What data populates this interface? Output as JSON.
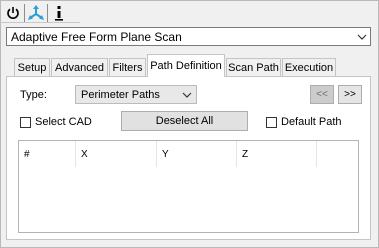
{
  "toolbar": {
    "icons": [
      "power-icon",
      "move-axes-icon",
      "info-icon"
    ],
    "power_glyph": "⏻",
    "move_glyph": "✥",
    "info_glyph": "i"
  },
  "scan_type": {
    "selected": "Adaptive Free Form Plane Scan"
  },
  "tabs": [
    {
      "label": "Setup",
      "active": false
    },
    {
      "label": "Advanced",
      "active": false
    },
    {
      "label": "Filters",
      "active": false
    },
    {
      "label": "Path Definition",
      "active": true
    },
    {
      "label": "Scan Path",
      "active": false
    },
    {
      "label": "Execution",
      "active": false
    }
  ],
  "path_definition": {
    "type_label": "Type:",
    "type_value": "Perimeter Paths",
    "prev_label": "<<",
    "next_label": ">>",
    "select_cad_label": "Select CAD",
    "select_cad_checked": false,
    "deselect_all_label": "Deselect All",
    "default_path_label": "Default Path",
    "default_path_checked": false,
    "table": {
      "columns": [
        "#",
        "X",
        "Y",
        "Z",
        ""
      ],
      "rows": []
    }
  },
  "colors": {
    "accent_icon": "#2a9fd6",
    "window_bg": "#f0f0f0"
  }
}
